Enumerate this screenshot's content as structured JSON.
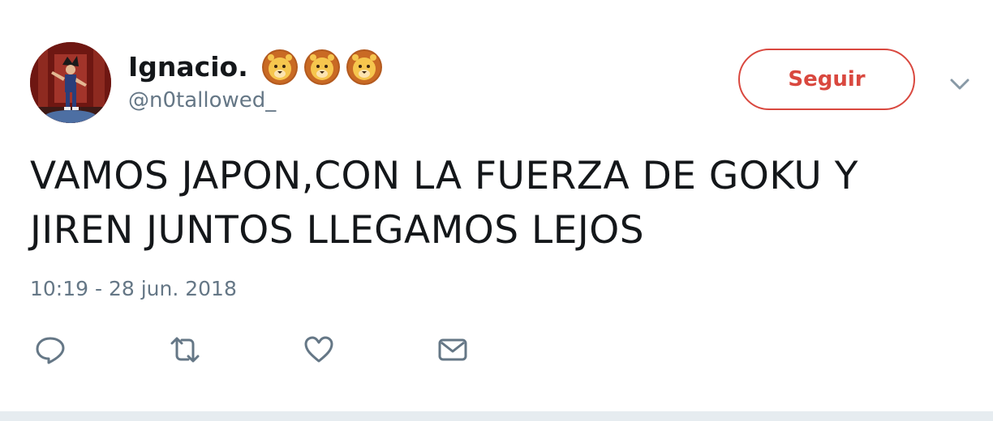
{
  "tweet": {
    "display_name": "Ignacio.",
    "name_emojis": [
      "lion-face-icon",
      "lion-face-icon",
      "lion-face-icon"
    ],
    "handle": "@n0tallowed_",
    "follow_label": "Seguir",
    "text": "VAMOS JAPON,CON LA FUERZA DE GOKU Y JIREN JUNTOS LLEGAMOS LEJOS",
    "timestamp": "10:19 - 28 jun. 2018"
  },
  "actions": [
    {
      "icon": "reply-icon"
    },
    {
      "icon": "retweet-icon"
    },
    {
      "icon": "like-icon"
    },
    {
      "icon": "direct-message-icon"
    }
  ],
  "colors": {
    "follow_accent": "#d9483f",
    "text_primary": "#14171a",
    "text_secondary": "#657786",
    "icon_gray": "#657786"
  }
}
